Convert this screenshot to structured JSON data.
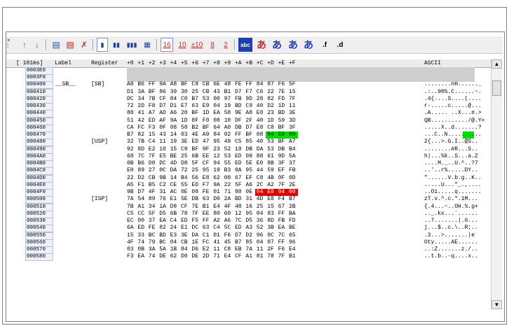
{
  "header": {
    "time": "[ 101ms]",
    "label": "Label",
    "register": "Register",
    "cols": [
      "+0",
      "+1",
      "+2",
      "+3",
      "+4",
      "+5",
      "+6",
      "+7",
      "+8",
      "+9",
      "+A",
      "+B",
      "+C",
      "+D",
      "+E",
      "+F"
    ],
    "ascii": "ASCII"
  },
  "toolbar": {
    "grip": "×\n⁞",
    "buttons": [
      "↑",
      "↓",
      "▤",
      "▤",
      "✗",
      "▮",
      "▮▮",
      "▮▮▮",
      "▦",
      "16",
      "10",
      "±10",
      "8",
      "2",
      "abc",
      "あ",
      "あ",
      "あ",
      "あ",
      ".f",
      ".d"
    ]
  },
  "rows": [
    {
      "addr": "0003E0",
      "label": "",
      "reg": "",
      "bytes": [],
      "ascii": "",
      "blank": true
    },
    {
      "addr": "0003F0",
      "label": "",
      "reg": "",
      "bytes": [],
      "ascii": "",
      "blank": true
    },
    {
      "addr": "000400",
      "label": "__SB__",
      "reg": "[SB]",
      "bytes": [
        "A8",
        "B6",
        "FF",
        "9A",
        "A8",
        "BF",
        "C9",
        "CB",
        "6E",
        "48",
        "FE",
        "FF",
        "84",
        "87",
        "F6",
        "5F"
      ],
      "ascii": "........nH......_"
    },
    {
      "addr": "000410",
      "label": "",
      "reg": "",
      "bytes": [
        "D1",
        "3A",
        "BF",
        "86",
        "39",
        "30",
        "25",
        "CB",
        "43",
        "B1",
        "D7",
        "F7",
        "C6",
        "22",
        "7E",
        "15"
      ],
      "ascii": ".:..90%.C......~."
    },
    {
      "addr": "000420",
      "label": "",
      "reg": "",
      "bytes": [
        "DC",
        "34",
        "7B",
        "CF",
        "84",
        "C0",
        "B7",
        "53",
        "00",
        "97",
        "FB",
        "9D",
        "28",
        "82",
        "FD",
        "7F"
      ],
      "ascii": ".4{....S....(...."
    },
    {
      "addr": "000430",
      "label": "",
      "reg": "",
      "bytes": [
        "72",
        "2D",
        "F8",
        "D7",
        "D1",
        "E7",
        "63",
        "E9",
        "04",
        "19",
        "BD",
        "C9",
        "40",
        "D2",
        "1D",
        "11"
      ],
      "ascii": "r-.....c.....@..."
    },
    {
      "addr": "000440",
      "label": "",
      "reg": "",
      "bytes": [
        "88",
        "41",
        "A7",
        "AD",
        "A6",
        "20",
        "BF",
        "1D",
        "EA",
        "58",
        "9E",
        "A8",
        "E0",
        "23",
        "BD",
        "3E"
      ],
      "ascii": ".A..... ..X...#.>"
    },
    {
      "addr": "000450",
      "label": "",
      "reg": "",
      "bytes": [
        "51",
        "42",
        "ED",
        "AF",
        "9A",
        "1D",
        "8F",
        "F0",
        "08",
        "10",
        "DF",
        "2F",
        "40",
        "1D",
        "59",
        "3D"
      ],
      "ascii": "QB.........../@.Y="
    },
    {
      "addr": "000460",
      "label": "",
      "reg": "",
      "bytes": [
        "CA",
        "FC",
        "F3",
        "0F",
        "08",
        "58",
        "B2",
        "BF",
        "64",
        "A0",
        "DB",
        "D7",
        "E8",
        "C8",
        "BF",
        "3F"
      ],
      "ascii": ".....X..d.......?"
    },
    {
      "addr": "000470",
      "label": "",
      "reg": "",
      "bytes": [
        "B7",
        "82",
        "15",
        "43",
        "14",
        "03",
        "4E",
        "A9",
        "84",
        "02",
        "FF",
        "BF",
        "08",
        "94",
        "E0",
        "00"
      ],
      "ascii": "...C..N..........",
      "hl": "green",
      "hlFrom": 13
    },
    {
      "addr": "000480",
      "label": "",
      "reg": "[USP]",
      "bytes": [
        "32",
        "7B",
        "C4",
        "11",
        "19",
        "3E",
        "ED",
        "47",
        "95",
        "49",
        "C5",
        "85",
        "40",
        "53",
        "BF",
        "A7"
      ],
      "ascii": "2{...>.G.I..@S.."
    },
    {
      "addr": "000490",
      "label": "",
      "reg": "",
      "bytes": [
        "92",
        "8D",
        "E2",
        "10",
        "15",
        "C9",
        "BF",
        "9F",
        "23",
        "52",
        "19",
        "DB",
        "DA",
        "53",
        "DB",
        "B4"
      ],
      "ascii": "........#R...S.."
    },
    {
      "addr": "0004A0",
      "label": "",
      "reg": "",
      "bytes": [
        "68",
        "7C",
        "7F",
        "E5",
        "BE",
        "25",
        "6B",
        "EE",
        "12",
        "53",
        "ED",
        "08",
        "88",
        "61",
        "9D",
        "5A"
      ],
      "ascii": "h|...%k..S...a.Z"
    },
    {
      "addr": "0004B0",
      "label": "",
      "reg": "",
      "bytes": [
        "0B",
        "B6",
        "D0",
        "DC",
        "4D",
        "D8",
        "5F",
        "CF",
        "94",
        "55",
        "ED",
        "5E",
        "E0",
        "8B",
        "3F",
        "37"
      ],
      "ascii": "....M._..U.^..?7"
    },
    {
      "addr": "0004C0",
      "label": "",
      "reg": "",
      "bytes": [
        "E0",
        "89",
        "27",
        "0C",
        "DA",
        "72",
        "25",
        "95",
        "19",
        "B3",
        "0A",
        "95",
        "44",
        "59",
        "EF",
        "FB"
      ],
      "ascii": "..'..r%.....DY.."
    },
    {
      "addr": "0004D0",
      "label": "",
      "reg": "",
      "bytes": [
        "22",
        "D2",
        "CB",
        "9B",
        "14",
        "B4",
        "56",
        "E8",
        "62",
        "00",
        "67",
        "EF",
        "C8",
        "4B",
        "0F",
        "0D"
      ],
      "ascii": "\"......V.b.g..K.."
    },
    {
      "addr": "0004E0",
      "label": "",
      "reg": "",
      "bytes": [
        "A5",
        "F1",
        "B5",
        "C2",
        "CE",
        "55",
        "ED",
        "F7",
        "9A",
        "22",
        "5F",
        "A6",
        "2C",
        "A2",
        "7F",
        "2E"
      ],
      "ascii": ".....U...\"_.,...."
    },
    {
      "addr": "0004F0",
      "label": "",
      "reg": "",
      "bytes": [
        "9B",
        "D7",
        "4F",
        "31",
        "AC",
        "0E",
        "08",
        "FE",
        "01",
        "71",
        "88",
        "0E",
        "94",
        "E0",
        "04",
        "00"
      ],
      "ascii": "..O1.....q.......",
      "hl": "red",
      "hlFrom": 12
    },
    {
      "addr": "000500",
      "label": "",
      "reg": "[ISP]",
      "bytes": [
        "7A",
        "54",
        "89",
        "76",
        "E1",
        "5E",
        "DB",
        "63",
        "D0",
        "2A",
        "BD",
        "31",
        "4D",
        "E8",
        "F4",
        "B7"
      ],
      "ascii": "zT.v.^.c.*.1M..."
    },
    {
      "addr": "000510",
      "label": "",
      "reg": "",
      "bytes": [
        "7B",
        "A1",
        "34",
        "1A",
        "D8",
        "CF",
        "7E",
        "B1",
        "E4",
        "4F",
        "48",
        "16",
        "25",
        "15",
        "67",
        "2B"
      ],
      "ascii": "{.4...~..OH.%.g+"
    },
    {
      "addr": "000520",
      "label": "",
      "reg": "",
      "bytes": [
        "C5",
        "CC",
        "5F",
        "D5",
        "6B",
        "78",
        "7F",
        "EE",
        "80",
        "60",
        "12",
        "95",
        "04",
        "83",
        "FF",
        "BA"
      ],
      "ascii": ".._.kx...`......"
    },
    {
      "addr": "000530",
      "label": "",
      "reg": "",
      "bytes": [
        "EC",
        "00",
        "37",
        "EA",
        "C4",
        "ED",
        "F5",
        "FF",
        "A2",
        "A6",
        "7C",
        "D5",
        "36",
        "8D",
        "FB",
        "FD"
      ],
      "ascii": "..7.......|.6..."
    },
    {
      "addr": "000540",
      "label": "",
      "reg": "",
      "bytes": [
        "6A",
        "ED",
        "FE",
        "82",
        "24",
        "E1",
        "DC",
        "63",
        "C4",
        "5C",
        "ED",
        "A3",
        "52",
        "3B",
        "EA",
        "BE"
      ],
      "ascii": "j...$..c.\\..R;.."
    },
    {
      "addr": "000550",
      "label": "",
      "reg": "",
      "bytes": [
        "15",
        "33",
        "BC",
        "BD",
        "E3",
        "3E",
        "DA",
        "C1",
        "01",
        "F6",
        "D7",
        "D2",
        "96",
        "0C",
        "7C",
        "65"
      ],
      "ascii": ".3...>.......|e"
    },
    {
      "addr": "000560",
      "label": "",
      "reg": "",
      "bytes": [
        "4F",
        "74",
        "79",
        "BC",
        "04",
        "CB",
        "1E",
        "FC",
        "41",
        "45",
        "B7",
        "85",
        "04",
        "07",
        "FF",
        "96"
      ],
      "ascii": "Oty.....AE......"
    },
    {
      "addr": "000570",
      "label": "",
      "reg": "",
      "bytes": [
        "03",
        "0B",
        "3A",
        "5A",
        "1B",
        "84",
        "D6",
        "E2",
        "11",
        "C8",
        "EB",
        "7A",
        "11",
        "2F",
        "F6",
        "E4"
      ],
      "ascii": "..:Z.......z./.."
    },
    {
      "addr": "000580",
      "label": "",
      "reg": "",
      "bytes": [
        "F3",
        "EA",
        "74",
        "DE",
        "62",
        "D0",
        "DE",
        "2D",
        "71",
        "E4",
        "CF",
        "A1",
        "81",
        "78",
        "7F",
        "B1"
      ],
      "ascii": "..t.b..-q....x.."
    }
  ]
}
